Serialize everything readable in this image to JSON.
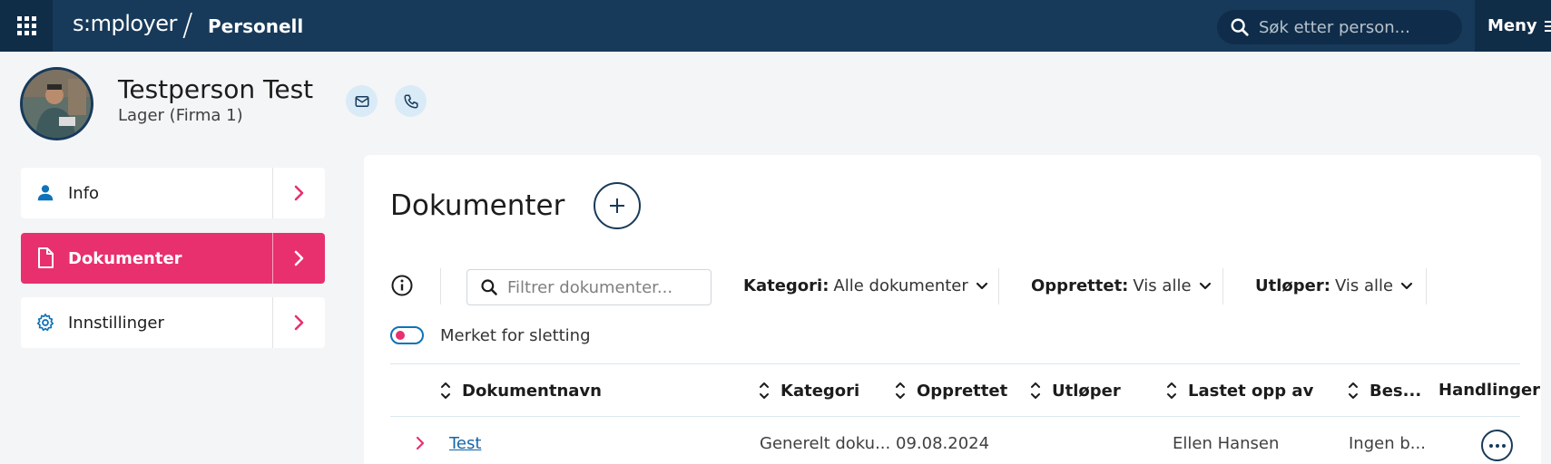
{
  "topbar": {
    "brand": "s:mployer",
    "separator": "/",
    "product": "Personell",
    "search_placeholder": "Søk etter person...",
    "menu_label": "Meny"
  },
  "person": {
    "name": "Testperson Test",
    "subtitle": "Lager (Firma 1)"
  },
  "sidebar": {
    "items": [
      {
        "label": "Info",
        "icon": "person-icon",
        "active": false
      },
      {
        "label": "Dokumenter",
        "icon": "document-icon",
        "active": true
      },
      {
        "label": "Innstillinger",
        "icon": "gear-icon",
        "active": false
      }
    ]
  },
  "documents": {
    "title": "Dokumenter",
    "filter_placeholder": "Filtrer dokumenter...",
    "filters": [
      {
        "key": "Kategori:",
        "value": "Alle dokumenter"
      },
      {
        "key": "Opprettet:",
        "value": "Vis alle"
      },
      {
        "key": "Utløper:",
        "value": "Vis alle"
      }
    ],
    "toggle_label": "Merket for sletting",
    "toggle_on": false,
    "columns": [
      "Dokumentnavn",
      "Kategori",
      "Opprettet",
      "Utløper",
      "Lastet opp av",
      "Bes...",
      "Handlinger"
    ],
    "rows": [
      {
        "name": "Test",
        "category": "Generelt doku...",
        "created": "09.08.2024",
        "expires": "",
        "uploaded_by": "Ellen Hansen",
        "description": "Ingen b..."
      }
    ]
  },
  "colors": {
    "topbar": "#183a5a",
    "accent": "#e8306f",
    "link": "#1565a8",
    "icon_bubble": "#d9ebf6"
  }
}
